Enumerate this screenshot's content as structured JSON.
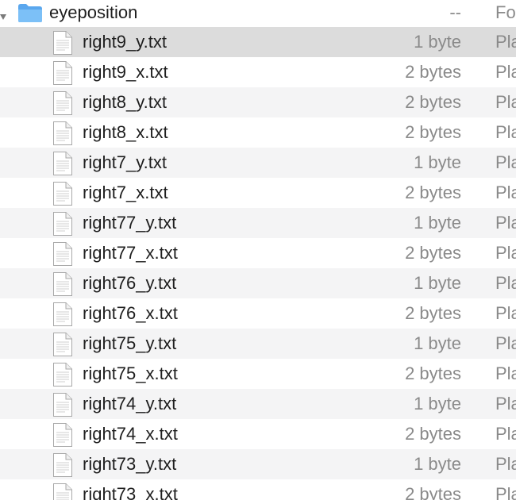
{
  "folder": {
    "name": "eyeposition",
    "size": "--",
    "kind": "Fo"
  },
  "files": [
    {
      "name": "right9_y.txt",
      "size": "1 byte",
      "kind": "Pla"
    },
    {
      "name": "right9_x.txt",
      "size": "2 bytes",
      "kind": "Pla"
    },
    {
      "name": "right8_y.txt",
      "size": "2 bytes",
      "kind": "Pla"
    },
    {
      "name": "right8_x.txt",
      "size": "2 bytes",
      "kind": "Pla"
    },
    {
      "name": "right7_y.txt",
      "size": "1 byte",
      "kind": "Pla"
    },
    {
      "name": "right7_x.txt",
      "size": "2 bytes",
      "kind": "Pla"
    },
    {
      "name": "right77_y.txt",
      "size": "1 byte",
      "kind": "Pla"
    },
    {
      "name": "right77_x.txt",
      "size": "2 bytes",
      "kind": "Pla"
    },
    {
      "name": "right76_y.txt",
      "size": "1 byte",
      "kind": "Pla"
    },
    {
      "name": "right76_x.txt",
      "size": "2 bytes",
      "kind": "Pla"
    },
    {
      "name": "right75_y.txt",
      "size": "1 byte",
      "kind": "Pla"
    },
    {
      "name": "right75_x.txt",
      "size": "2 bytes",
      "kind": "Pla"
    },
    {
      "name": "right74_y.txt",
      "size": "1 byte",
      "kind": "Pla"
    },
    {
      "name": "right74_x.txt",
      "size": "2 bytes",
      "kind": "Pla"
    },
    {
      "name": "right73_y.txt",
      "size": "1 byte",
      "kind": "Pla"
    },
    {
      "name": "right73_x.txt",
      "size": "2 bytes",
      "kind": "Pla"
    }
  ],
  "icons": {
    "disclosure": "disclosure-triangle-icon",
    "folder": "folder-icon",
    "file": "text-document-icon"
  },
  "colors": {
    "folder_blue": "#6db3f2",
    "selected_row": "#dcdcdc",
    "stripe": "#f4f4f5",
    "secondary_text": "#8a8a8a"
  }
}
